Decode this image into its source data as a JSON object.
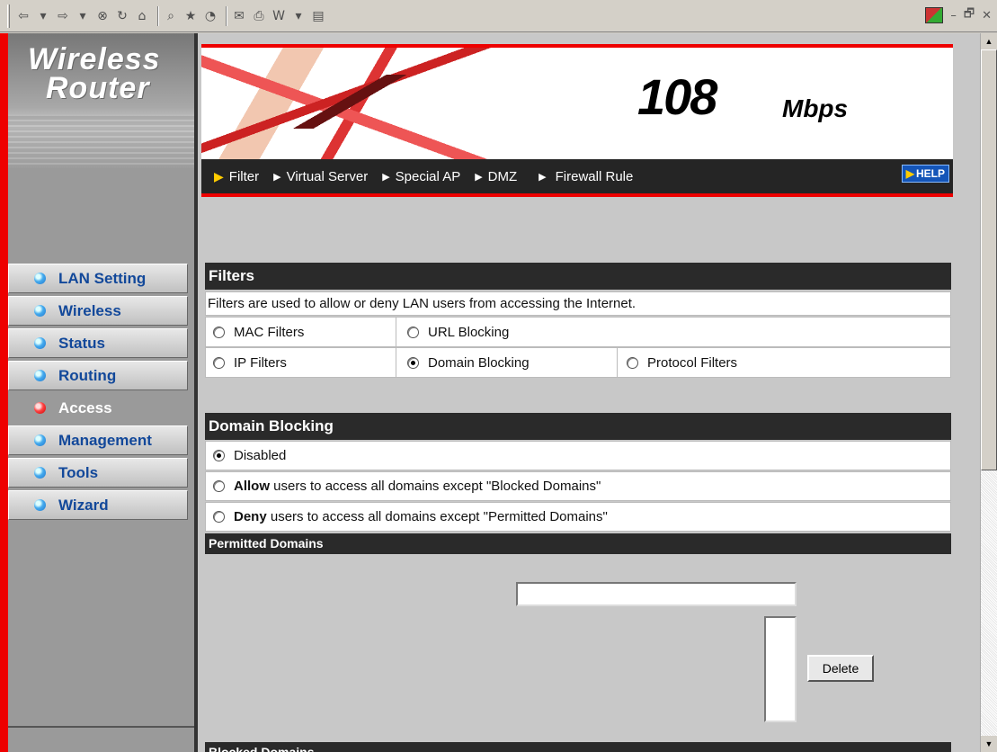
{
  "browser_toolbar": {
    "icons": [
      "back-icon",
      "dropdown-icon",
      "forward-icon",
      "dropdown-icon",
      "stop-icon",
      "refresh-icon",
      "home-icon",
      "search-icon",
      "favorites-icon",
      "history-icon",
      "mail-icon",
      "print-icon",
      "edit-icon",
      "dropdown-icon",
      "discuss-icon"
    ],
    "glyphs": {
      "back": "⇦",
      "forward": "⇨",
      "caret": "▾",
      "stop": "⊗",
      "refresh": "↻",
      "home": "⌂",
      "search": "⌕",
      "favorites": "★",
      "history": "◔",
      "mail": "✉",
      "print": "⎙",
      "edit": "W",
      "discuss": "▤"
    },
    "window_controls": {
      "minimize": "–",
      "restore": "🗗",
      "close": "✕"
    }
  },
  "brand": {
    "line1": "Wireless",
    "line2": "Router"
  },
  "banner": {
    "speed": "108",
    "unit": "Mbps"
  },
  "tabs": [
    {
      "label": "Filter",
      "active": true
    },
    {
      "label": "Virtual Server",
      "active": false
    },
    {
      "label": "Special AP",
      "active": false
    },
    {
      "label": "DMZ",
      "active": false
    },
    {
      "label": "Firewall Rule",
      "active": false
    }
  ],
  "help_label": "HELP",
  "nav": [
    {
      "label": "LAN Setting",
      "active": false
    },
    {
      "label": "Wireless",
      "active": false
    },
    {
      "label": "Status",
      "active": false
    },
    {
      "label": "Routing",
      "active": false
    },
    {
      "label": "Access",
      "active": true
    },
    {
      "label": "Management",
      "active": false
    },
    {
      "label": "Tools",
      "active": false
    },
    {
      "label": "Wizard",
      "active": false
    }
  ],
  "filters": {
    "title": "Filters",
    "description": "Filters are used to allow or deny LAN users from accessing the Internet.",
    "options": {
      "mac": "MAC Filters",
      "url": "URL Blocking",
      "ip": "IP Filters",
      "domain": "Domain Blocking",
      "protocol": "Protocol Filters"
    },
    "selected": "Domain Blocking"
  },
  "domain_blocking": {
    "title": "Domain Blocking",
    "disabled_label": "Disabled",
    "allow_bold": "Allow",
    "allow_rest": " users to access all domains except \"Blocked Domains\"",
    "deny_bold": "Deny",
    "deny_rest": " users to access all domains except \"Permitted Domains\"",
    "selected": "Disabled"
  },
  "permitted_domains": {
    "title": "Permitted Domains",
    "input_value": "",
    "delete_label": "Delete"
  },
  "blocked_domains": {
    "title": "Blocked Domains"
  },
  "colors": {
    "accent_red": "#e00000",
    "dark_bar": "#2a2a2a",
    "nav_text": "#12489a"
  }
}
